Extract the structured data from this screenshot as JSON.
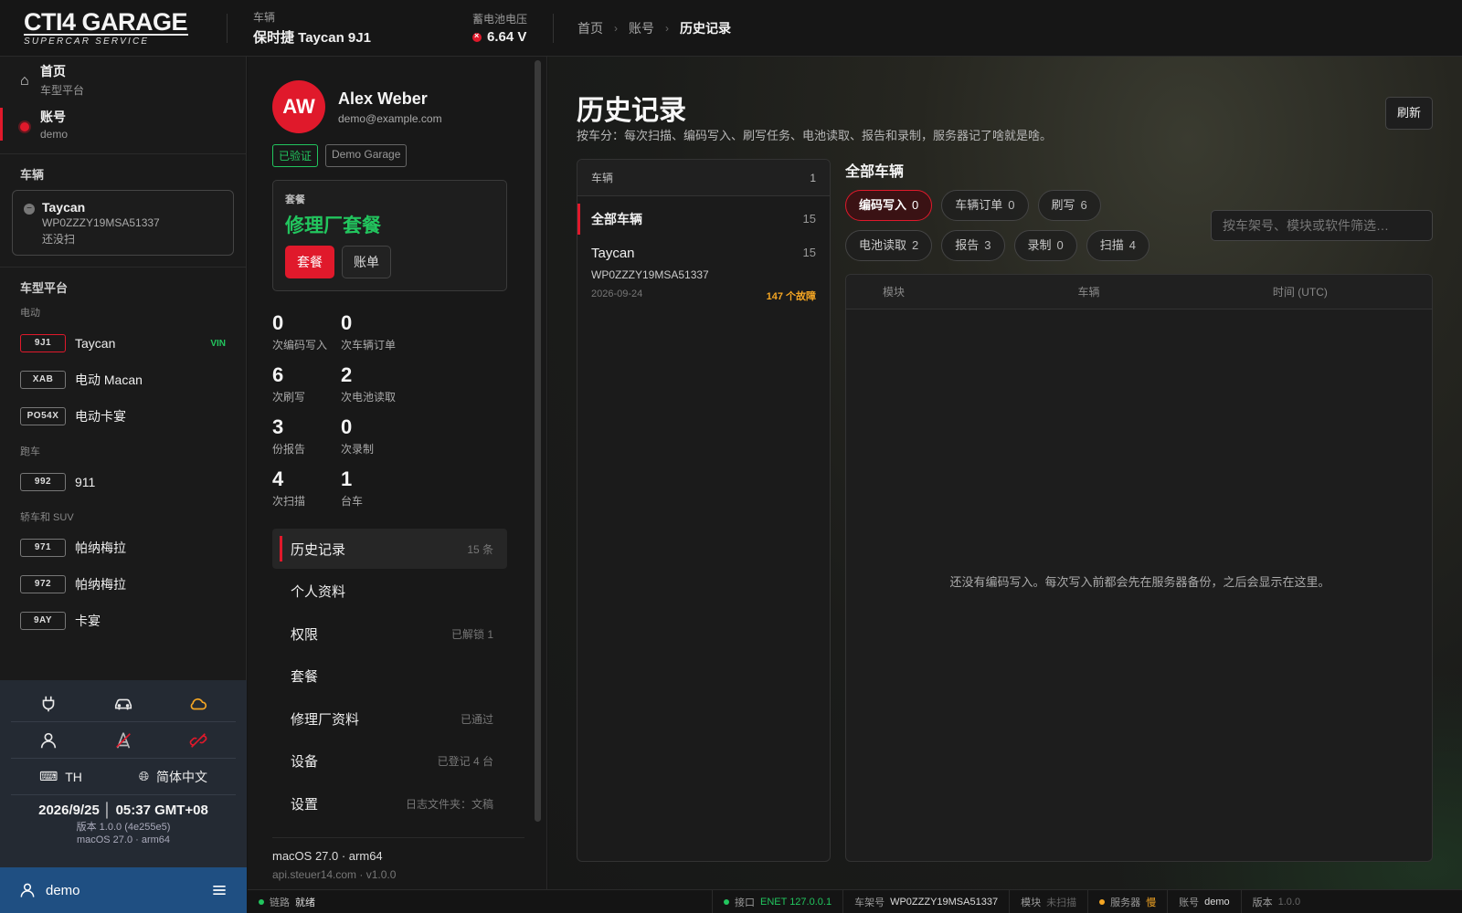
{
  "topbar": {
    "logo_main": "CTI4 GARAGE",
    "logo_sub": "SUPERCAR SERVICE",
    "vehicle_label": "车辆",
    "vehicle_value": "保时捷 Taycan 9J1",
    "battery_label": "蓄电池电压",
    "battery_value": "6.64 V",
    "breadcrumb": [
      "首页",
      "账号",
      "历史记录"
    ]
  },
  "sidebar": {
    "nav": [
      {
        "title": "首页",
        "sub": "车型平台"
      },
      {
        "title": "账号",
        "sub": "demo"
      }
    ],
    "vehicle_section": "车辆",
    "vehicle_card": {
      "name": "Taycan",
      "vin": "WP0ZZZY19MSA51337",
      "status": "还没扫"
    },
    "platform_section": "车型平台",
    "groups": [
      {
        "label": "电动",
        "items": [
          {
            "code": "9J1",
            "name": "Taycan",
            "tag": "VIN"
          },
          {
            "code": "XAB",
            "name": "电动 Macan",
            "tag": ""
          },
          {
            "code": "PO54X",
            "name": "电动卡宴",
            "tag": ""
          }
        ]
      },
      {
        "label": "跑车",
        "items": [
          {
            "code": "992",
            "name": "911",
            "tag": ""
          }
        ]
      },
      {
        "label": "轿车和 SUV",
        "items": [
          {
            "code": "971",
            "name": "帕纳梅拉",
            "tag": ""
          },
          {
            "code": "972",
            "name": "帕纳梅拉",
            "tag": ""
          },
          {
            "code": "9AY",
            "name": "卡宴",
            "tag": ""
          }
        ]
      }
    ],
    "keyboard": "TH",
    "language": "简体中文",
    "datetime": "2026/9/25 │ 05:37 GMT+08",
    "version": "版本 1.0.0 (4e255e5)",
    "os": "macOS 27.0 · arm64",
    "user": "demo"
  },
  "profile": {
    "initials": "AW",
    "name": "Alex Weber",
    "email": "demo@example.com",
    "badge_verified": "已验证",
    "badge_garage": "Demo Garage",
    "plan_label": "套餐",
    "plan_name": "修理厂套餐",
    "plan_btn": "套餐",
    "bill_btn": "账单",
    "stats": [
      {
        "n": "0",
        "l": "次编码写入"
      },
      {
        "n": "0",
        "l": "次车辆订单"
      },
      {
        "n": "6",
        "l": "次刷写"
      },
      {
        "n": "2",
        "l": "次电池读取"
      },
      {
        "n": "3",
        "l": "份报告"
      },
      {
        "n": "0",
        "l": "次录制"
      },
      {
        "n": "4",
        "l": "次扫描"
      },
      {
        "n": "1",
        "l": "台车"
      }
    ],
    "menu": [
      {
        "label": "历史记录",
        "right": "15 条"
      },
      {
        "label": "个人资料",
        "right": ""
      },
      {
        "label": "权限",
        "right": "已解锁 1"
      },
      {
        "label": "套餐",
        "right": ""
      },
      {
        "label": "修理厂资料",
        "right": "已通过"
      },
      {
        "label": "设备",
        "right": "已登记 4 台"
      },
      {
        "label": "设置",
        "right": "日志文件夹：文稿"
      }
    ],
    "foot_os": "macOS 27.0 · arm64",
    "foot_api": "api.steuer14.com  ·  v1.0.0"
  },
  "main": {
    "title": "历史记录",
    "subtitle": "按车分：每次扫描、编码写入、刷写任务、电池读取、报告和录制，服务器记了啥就是啥。",
    "refresh": "刷新",
    "list_header": "车辆",
    "list_count": "1",
    "all_label": "全部车辆",
    "all_count": "15",
    "vehicle": {
      "name": "Taycan",
      "count": "15",
      "vin": "WP0ZZZY19MSA51337",
      "date": "2026-09-24",
      "faults": "147 个故障"
    },
    "right_title": "全部车辆",
    "chips": [
      {
        "label": "编码写入",
        "n": "0"
      },
      {
        "label": "车辆订单",
        "n": "0"
      },
      {
        "label": "刷写",
        "n": "6"
      },
      {
        "label": "电池读取",
        "n": "2"
      },
      {
        "label": "报告",
        "n": "3"
      },
      {
        "label": "录制",
        "n": "0"
      },
      {
        "label": "扫描",
        "n": "4"
      }
    ],
    "filter_placeholder": "按车架号、模块或软件筛选…",
    "columns": [
      "模块",
      "车辆",
      "时间 (UTC)"
    ],
    "empty": "还没有编码写入。每次写入前都会先在服务器备份，之后会显示在这里。"
  },
  "status": {
    "link_label": "链路",
    "link_value": "就绪",
    "port_label": "接口",
    "port_value": "ENET 127.0.0.1",
    "vin_label": "车架号",
    "vin_value": "WP0ZZZY19MSA51337",
    "module_label": "模块",
    "module_value": "未扫描",
    "server_label": "服务器",
    "server_value": "慢",
    "account_label": "账号",
    "account_value": "demo",
    "version_label": "版本",
    "version_value": "1.0.0"
  },
  "colors": {
    "accent": "#e0192b",
    "green": "#22c55e",
    "orange": "#f5a623",
    "userbar": "#1f4f82"
  }
}
